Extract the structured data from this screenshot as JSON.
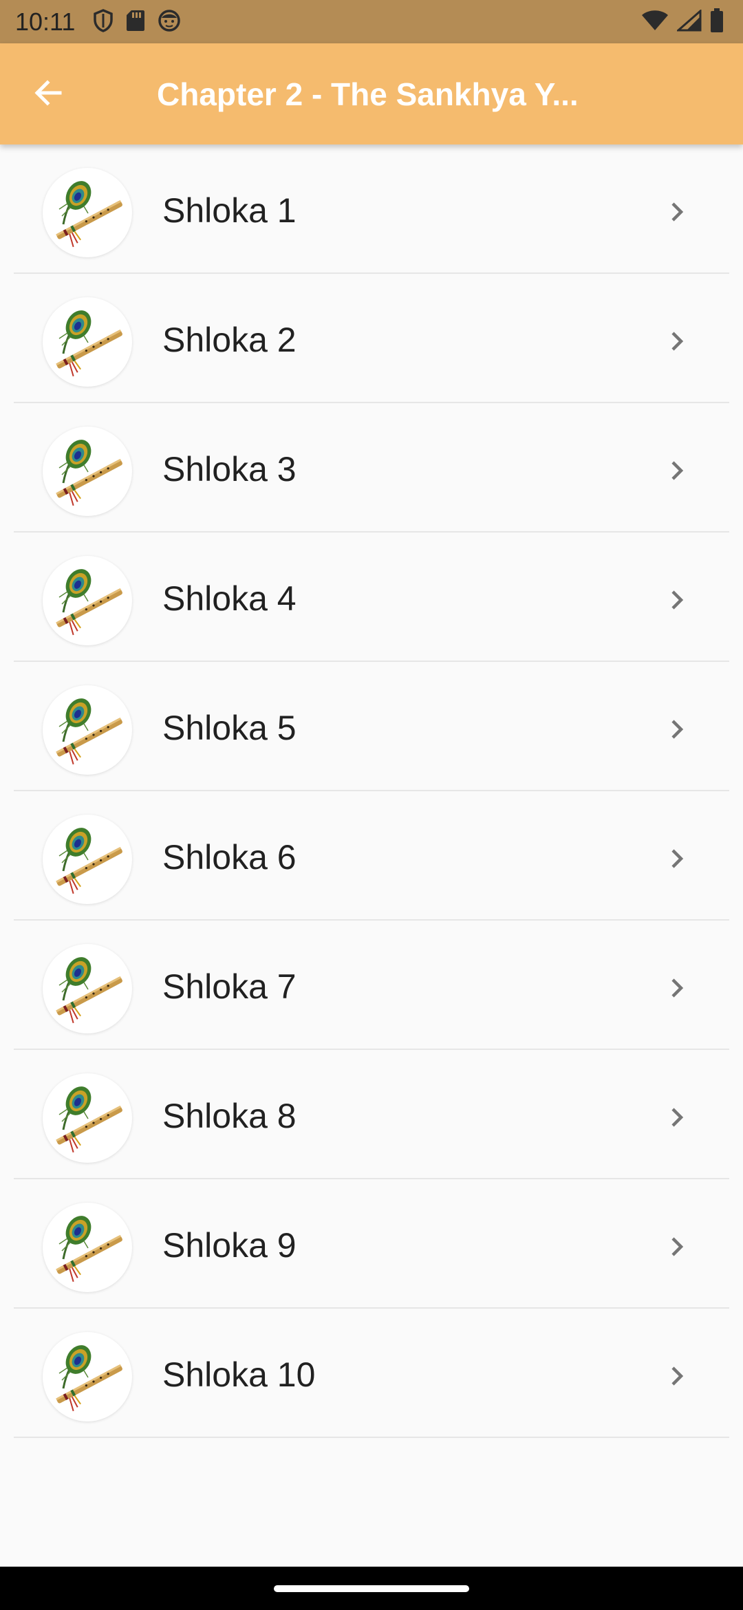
{
  "status_bar": {
    "time": "10:11",
    "left_icons": [
      "shield-icon",
      "sd-card-icon",
      "face-icon"
    ],
    "right_icons": [
      "wifi-icon",
      "signal-icon",
      "battery-icon"
    ]
  },
  "app_bar": {
    "back_icon": "arrow-left-icon",
    "title": "Chapter 2 - The Sankhya Y..."
  },
  "colors": {
    "status_bar": "#b48c55",
    "app_bar": "#f5bb6e",
    "title_text": "#ffffff",
    "list_background": "#fafafa",
    "divider": "#e6e6e6"
  },
  "list": {
    "items": [
      {
        "label": "Shloka 1",
        "icon": "peacock-feather-flute-icon"
      },
      {
        "label": "Shloka 2",
        "icon": "peacock-feather-flute-icon"
      },
      {
        "label": "Shloka 3",
        "icon": "peacock-feather-flute-icon"
      },
      {
        "label": "Shloka 4",
        "icon": "peacock-feather-flute-icon"
      },
      {
        "label": "Shloka 5",
        "icon": "peacock-feather-flute-icon"
      },
      {
        "label": "Shloka 6",
        "icon": "peacock-feather-flute-icon"
      },
      {
        "label": "Shloka 7",
        "icon": "peacock-feather-flute-icon"
      },
      {
        "label": "Shloka 8",
        "icon": "peacock-feather-flute-icon"
      },
      {
        "label": "Shloka 9",
        "icon": "peacock-feather-flute-icon"
      },
      {
        "label": "Shloka 10",
        "icon": "peacock-feather-flute-icon"
      }
    ]
  }
}
